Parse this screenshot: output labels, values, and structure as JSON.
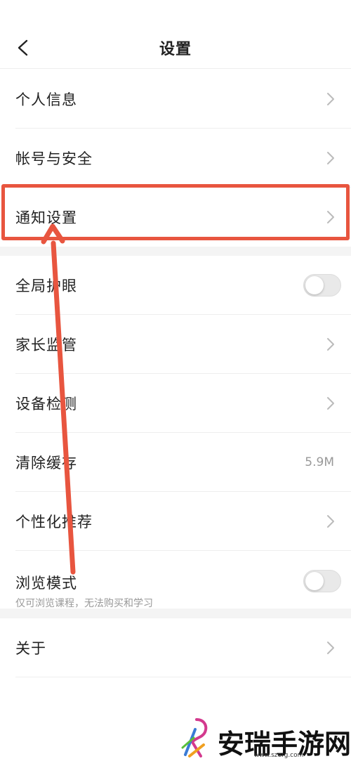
{
  "header": {
    "title": "设置",
    "back_icon": "chevron-left-icon"
  },
  "groups": [
    {
      "items": [
        {
          "label": "个人信息",
          "trailing": "chevron"
        },
        {
          "label": "帐号与安全",
          "trailing": "chevron"
        },
        {
          "label": "通知设置",
          "trailing": "chevron",
          "highlighted": true
        }
      ]
    },
    {
      "items": [
        {
          "label": "全局护眼",
          "trailing": "toggle",
          "toggle_on": false
        },
        {
          "label": "家长监管",
          "trailing": "chevron"
        },
        {
          "label": "设备检测",
          "trailing": "chevron"
        },
        {
          "label": "清除缓存",
          "trailing": "value",
          "value": "5.9M"
        },
        {
          "label": "个性化推荐",
          "trailing": "chevron"
        },
        {
          "label": "浏览模式",
          "sublabel": "仅可浏览课程，无法购买和学习",
          "trailing": "toggle",
          "toggle_on": false
        }
      ]
    },
    {
      "items": [
        {
          "label": "关于",
          "trailing": "chevron"
        }
      ]
    }
  ],
  "annotation": {
    "color": "#e8553f"
  },
  "watermark": {
    "text": "安瑞手游网",
    "url": "www.szerg.com"
  }
}
